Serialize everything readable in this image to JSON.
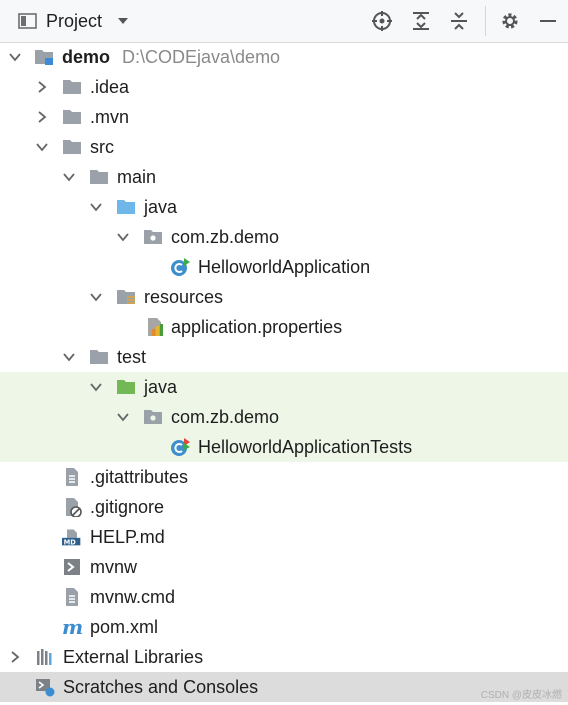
{
  "header": {
    "title": "Project",
    "view_icon": "panel-icon",
    "toolbar": [
      "locate-icon",
      "expand-all-icon",
      "collapse-all-icon",
      "gear-icon",
      "minimize-icon"
    ]
  },
  "tree": {
    "root": {
      "label": "demo",
      "path": "D:\\CODEjava\\demo",
      "icon": "module-folder-icon"
    },
    "idea": {
      "label": ".idea",
      "icon": "folder-icon"
    },
    "mvn": {
      "label": ".mvn",
      "icon": "folder-icon"
    },
    "src": {
      "label": "src",
      "icon": "folder-icon"
    },
    "main": {
      "label": "main",
      "icon": "folder-icon"
    },
    "main_java": {
      "label": "java",
      "icon": "source-root-folder-icon"
    },
    "main_pkg": {
      "label": "com.zb.demo",
      "icon": "package-icon"
    },
    "main_class": {
      "label": "HelloworldApplication",
      "icon": "spring-class-icon"
    },
    "resources": {
      "label": "resources",
      "icon": "resources-folder-icon"
    },
    "app_props": {
      "label": "application.properties",
      "icon": "properties-file-icon"
    },
    "test": {
      "label": "test",
      "icon": "folder-icon"
    },
    "test_java": {
      "label": "java",
      "icon": "test-root-folder-icon"
    },
    "test_pkg": {
      "label": "com.zb.demo",
      "icon": "package-icon"
    },
    "test_class": {
      "label": "HelloworldApplicationTests",
      "icon": "spring-test-class-icon"
    },
    "gitattributes": {
      "label": ".gitattributes",
      "icon": "text-file-icon"
    },
    "gitignore": {
      "label": ".gitignore",
      "icon": "ignore-file-icon"
    },
    "help": {
      "label": "HELP.md",
      "icon": "markdown-file-icon"
    },
    "mvnw": {
      "label": "mvnw",
      "icon": "shell-script-icon"
    },
    "mvnw_cmd": {
      "label": "mvnw.cmd",
      "icon": "text-file-icon"
    },
    "pom": {
      "label": "pom.xml",
      "icon": "maven-icon"
    },
    "ext_libs": {
      "label": "External Libraries",
      "icon": "libraries-icon"
    },
    "scratches": {
      "label": "Scratches and Consoles",
      "icon": "scratches-icon"
    }
  },
  "watermark": "CSDN @皮皮冰燃",
  "colors": {
    "folder": "#9aa1a9",
    "source_root": "#6fb7e8",
    "test_root": "#72b955",
    "highlight": "#eef6e8",
    "footer": "#dcdcdc"
  }
}
